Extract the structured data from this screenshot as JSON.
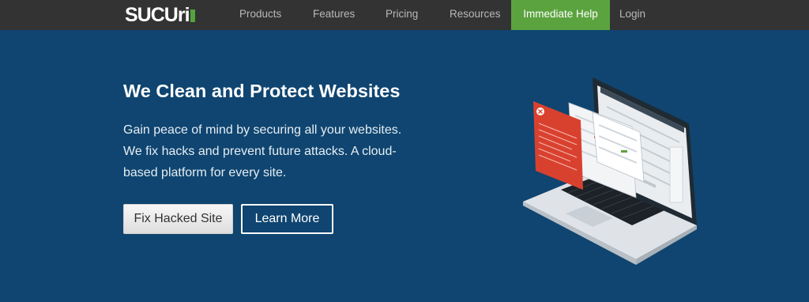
{
  "brand": {
    "name": "SUCUri"
  },
  "nav": {
    "items": [
      "Products",
      "Features",
      "Pricing",
      "Resources"
    ],
    "cta": "Immediate Help",
    "login": "Login"
  },
  "hero": {
    "title": "We Clean and Protect Websites",
    "lead": "Gain peace of mind by securing all your websites. We fix hacks and prevent future attacks. A cloud-based platform for every site.",
    "buttons": {
      "primary": "Fix Hacked Site",
      "secondary": "Learn More"
    }
  },
  "illustration": {
    "name": "laptop-dashboard-illustration"
  },
  "colors": {
    "nav_bg": "#333333",
    "hero_bg": "#0f4570",
    "accent_green": "#5ba33f",
    "alert_red": "#d9412f"
  }
}
